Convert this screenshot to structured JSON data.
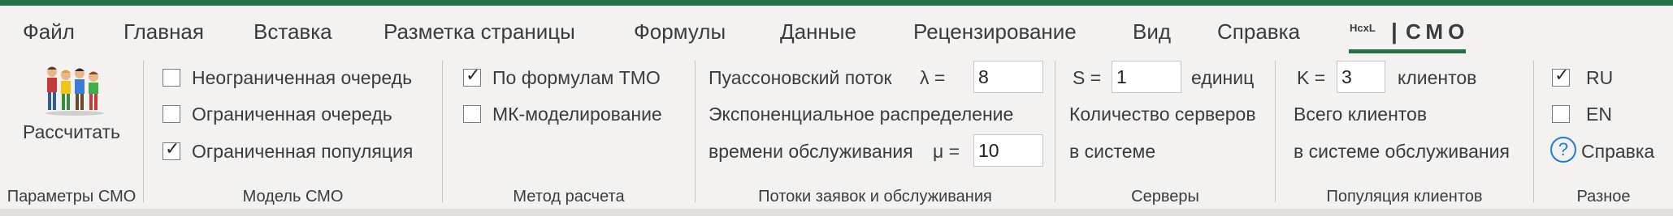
{
  "tabs": [
    {
      "label": "Файл"
    },
    {
      "label": "Главная"
    },
    {
      "label": "Вставка"
    },
    {
      "label": "Разметка страницы"
    },
    {
      "label": "Формулы"
    },
    {
      "label": "Данные"
    },
    {
      "label": "Рецензирование"
    },
    {
      "label": "Вид"
    },
    {
      "label": "Справка"
    },
    {
      "label": "СМО",
      "logo": "HcxL",
      "active": true
    }
  ],
  "groups": {
    "params": {
      "label": "Параметры СМО",
      "calc_button": "Рассчитать"
    },
    "model": {
      "label": "Модель СМО",
      "options": [
        {
          "label": "Неограниченная очередь",
          "checked": false
        },
        {
          "label": "Ограниченная очередь",
          "checked": false
        },
        {
          "label": "Ограниченная популяция",
          "checked": true
        }
      ]
    },
    "method": {
      "label": "Метод расчета",
      "options": [
        {
          "label": "По формулам ТМО",
          "checked": true
        },
        {
          "label": "МК-моделирование",
          "checked": false
        }
      ]
    },
    "flows": {
      "label": "Потоки заявок и обслуживания",
      "poisson_label": "Пуассоновский поток",
      "lambda_symbol": "λ =",
      "lambda_value": "8",
      "exp_label": "Экспоненциальное распределение",
      "service_label": "времени обслуживания",
      "mu_symbol": "μ =",
      "mu_value": "10"
    },
    "servers": {
      "label": "Серверы",
      "s_symbol": "S =",
      "s_value": "1",
      "unit": "единиц",
      "desc1": "Количество серверов",
      "desc2": "в системе"
    },
    "population": {
      "label": "Популяция клиентов",
      "k_symbol": "K =",
      "k_value": "3",
      "unit": "клиентов",
      "desc1": "Всего клиентов",
      "desc2": "в системе обслуживания"
    },
    "misc": {
      "label": "Разное",
      "options": [
        {
          "label": "RU",
          "checked": true
        },
        {
          "label": "EN",
          "checked": false
        }
      ],
      "help_label": "Справка",
      "help_icon_glyph": "?"
    }
  },
  "colors": {
    "accent": "#217346",
    "help": "#1e7bd6"
  }
}
